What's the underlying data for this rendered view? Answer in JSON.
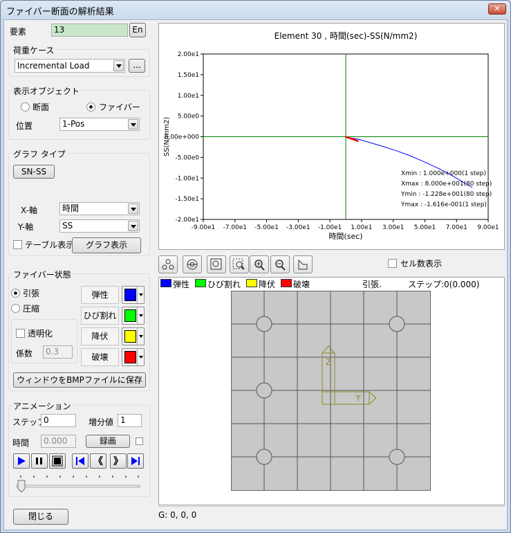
{
  "window": {
    "title": "ファイバー断面の解析結果",
    "close_glyph": "✕"
  },
  "element": {
    "label": "要素",
    "value": "13",
    "lang_button": "En"
  },
  "load_case": {
    "group": "荷重ケース",
    "selected": "Incremental Load",
    "browse_button": "..."
  },
  "display_object": {
    "group": "表示オブジェクト",
    "radio_section": "断面",
    "radio_fiber": "ファイバー",
    "position_label": "位置",
    "position_value": "1-Pos"
  },
  "graph_type": {
    "group": "グラフ タイプ",
    "type_button": "SN-SS",
    "x_axis_label": "X-軸",
    "x_axis_value": "時間",
    "y_axis_label": "Y-軸",
    "y_axis_value": "SS",
    "table_checkbox": "テーブル表示",
    "show_graph_button": "グラフ表示"
  },
  "fiber_state": {
    "group": "ファイバー状態",
    "radio_tension": "引張",
    "radio_compression": "圧縮",
    "transparent_checkbox": "透明化",
    "coef_label": "係数",
    "coef_value": "0.3",
    "states": [
      {
        "label": "弾性",
        "color": "#0000ff"
      },
      {
        "label": "ひび割れ",
        "color": "#00ff00"
      },
      {
        "label": "降伏",
        "color": "#ffff00"
      },
      {
        "label": "破壊",
        "color": "#ff0000"
      }
    ],
    "save_bmp_button": "ウィンドウをBMPファイルに保存"
  },
  "animation": {
    "group": "アニメーション",
    "step_label": "ステップ",
    "step_value": "0",
    "increment_label": "増分値",
    "increment_value": "1",
    "time_label": "時間",
    "time_value": "0.000",
    "record_button": "録画"
  },
  "close_button": "閉じる",
  "chart_data": {
    "type": "line",
    "title": "Element 30 , 時間(sec)-SS(N/mm2)",
    "xlabel": "時間(sec)",
    "ylabel": "SS(N/mm2)",
    "xlim": [
      -90,
      90
    ],
    "ylim": [
      -20,
      20
    ],
    "x_ticks": [
      "-9.00e1",
      "-7.00e1",
      "-5.00e1",
      "-3.00e1",
      "-1.00e1",
      "1.00e1",
      "3.00e1",
      "5.00e1",
      "7.00e1",
      "9.00e1"
    ],
    "y_ticks": [
      "2.00e1",
      "1.50e1",
      "1.00e1",
      "5.00e0",
      "0.00e+000",
      "-5.00e0",
      "-1.00e1",
      "-1.50e1",
      "-2.00e1"
    ],
    "grid": false,
    "series": [
      {
        "color": "#0000ff",
        "x": [
          1,
          8,
          16,
          24,
          32,
          40,
          48,
          56,
          64,
          72,
          80
        ],
        "y": [
          -0.16,
          -0.6,
          -1.5,
          -2.4,
          -3.4,
          -4.5,
          -5.8,
          -7.2,
          -8.7,
          -10.5,
          -12.28
        ]
      },
      {
        "color": "#ff0000",
        "x": [
          0,
          1,
          2,
          3,
          4,
          5,
          6,
          7,
          8
        ],
        "y": [
          0,
          -0.16,
          -0.3,
          -0.4,
          -0.55,
          -0.65,
          -0.8,
          -0.95,
          -1.1
        ]
      }
    ],
    "annotations": [
      "Xmin : 1.000e+000(1 step)",
      "Xmax : 8.000e+001(80 step)",
      "Ymin : -1.228e+001(80 step)",
      "Ymax : -1.616e-001(1 step)"
    ]
  },
  "section_view": {
    "cell_count_checkbox": "セル数表示",
    "legend": [
      {
        "label": "弾性",
        "color": "#0000ff"
      },
      {
        "label": "ひび割れ",
        "color": "#00ff00"
      },
      {
        "label": "降伏",
        "color": "#ffff00"
      },
      {
        "label": "破壊",
        "color": "#ff0000"
      }
    ],
    "mode_text": "引張.",
    "step_text": "ステップ:0(0.000)",
    "axis_z": "Z",
    "axis_y": "Y",
    "status_text": "G: 0, 0, 0"
  },
  "icons": [
    "fit-icon",
    "rotate-icon",
    "zoom-window-icon",
    "zoom-area-icon",
    "zoom-in-icon",
    "zoom-out-icon",
    "view-reset-icon"
  ]
}
